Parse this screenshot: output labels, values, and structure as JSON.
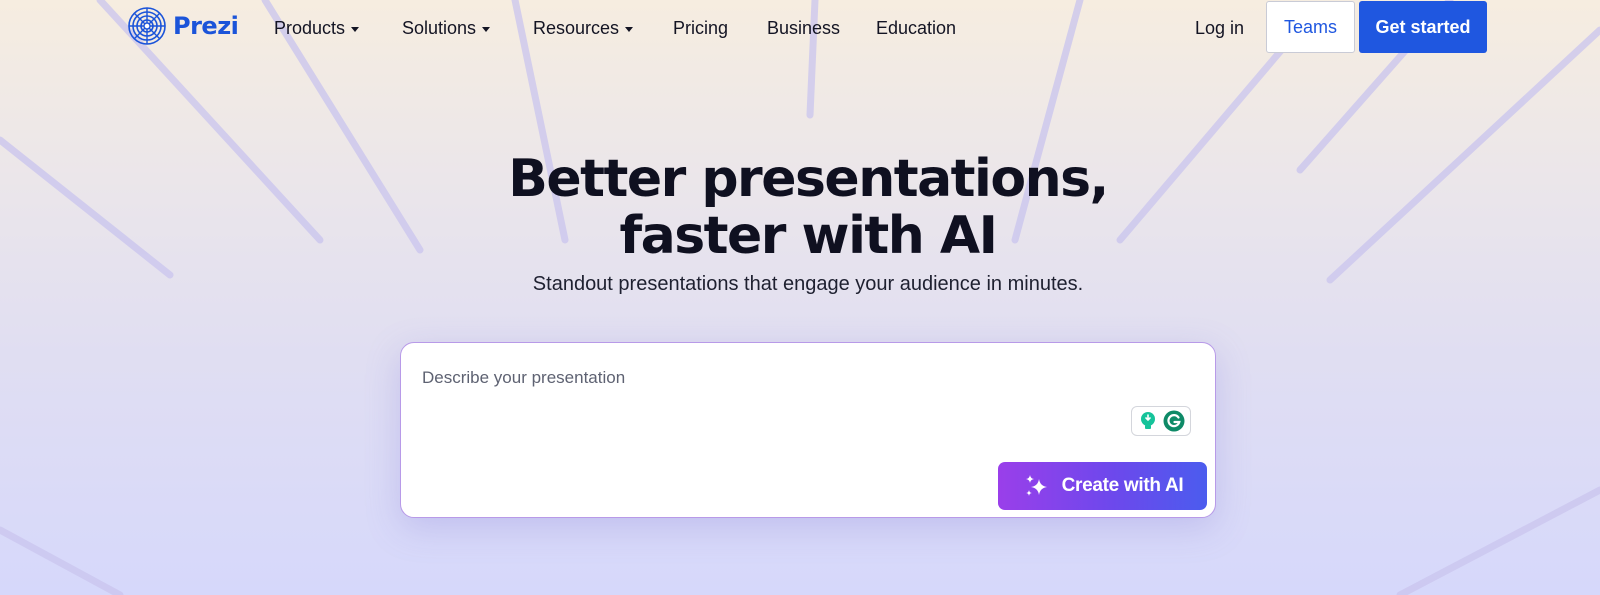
{
  "nav": {
    "logo_text": "Prezi",
    "menu": [
      {
        "label": "Products"
      },
      {
        "label": "Solutions"
      },
      {
        "label": "Resources"
      },
      {
        "label": "Pricing"
      },
      {
        "label": "Business"
      },
      {
        "label": "Education"
      }
    ],
    "login_label": "Log in",
    "teams_label": "Teams",
    "get_started_label": "Get started"
  },
  "hero": {
    "title_line1": "Better presentations,",
    "title_line2": "faster with AI",
    "subtitle": "Standout presentations that engage your audience in minutes."
  },
  "prompt": {
    "placeholder": "Describe your presentation",
    "value": "",
    "create_label": "Create with AI"
  },
  "icons": {
    "logo": "prezi-logo-icon",
    "dropdown": "caret-down-icon",
    "sparkle": "sparkle-icon",
    "extension_1": "lightbulb-icon",
    "extension_2": "grammarly-icon"
  },
  "colors": {
    "brand_blue": "#1f57e0",
    "logo_blue": "#1b54d9",
    "ai_gradient_start": "#9a3fea",
    "ai_gradient_end": "#4b5cee",
    "text_dark": "#0f1020"
  }
}
